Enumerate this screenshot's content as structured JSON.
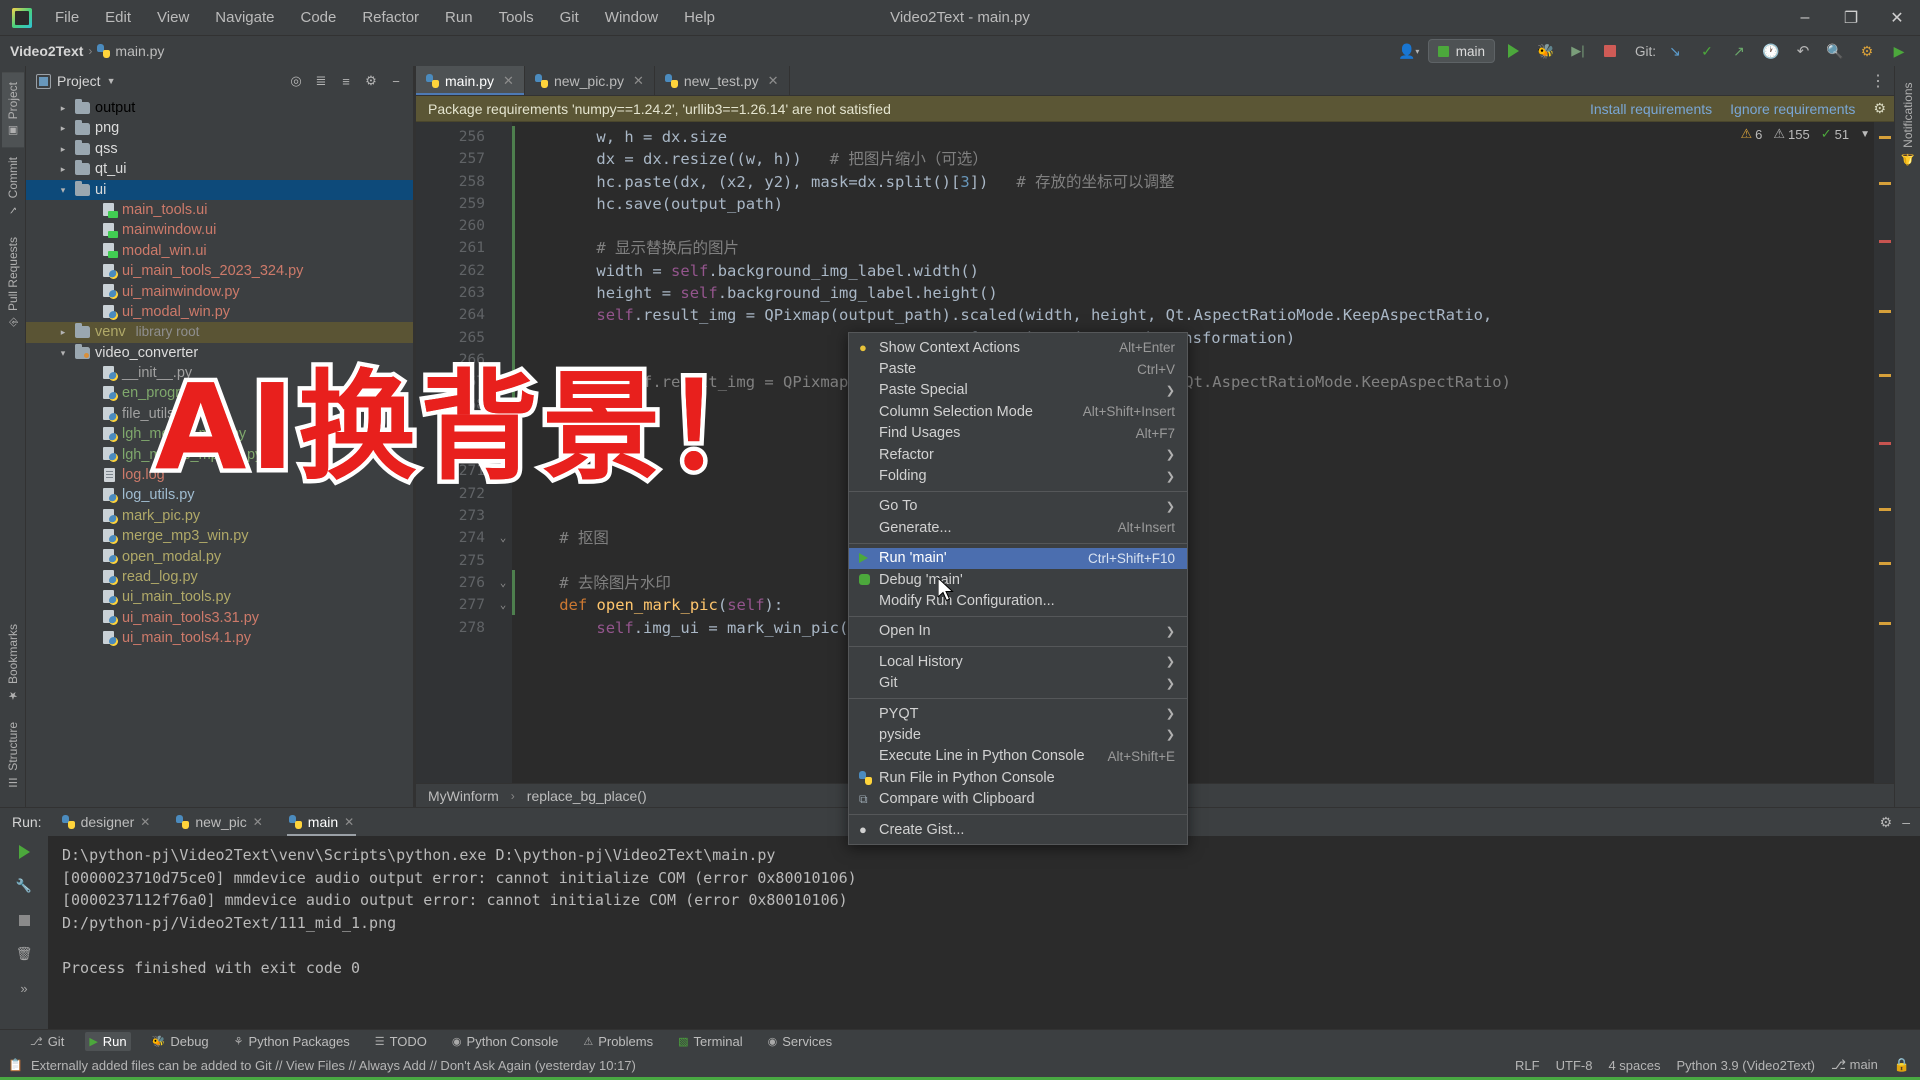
{
  "window": {
    "title": "Video2Text - main.py",
    "logo_icon": "pycharm-logo-icon",
    "minimize_icon": "–",
    "maximize_icon": "❐",
    "close_icon": "✕"
  },
  "menubar": [
    "File",
    "Edit",
    "View",
    "Navigate",
    "Code",
    "Refactor",
    "Run",
    "Tools",
    "Git",
    "Window",
    "Help"
  ],
  "breadcrumb": {
    "project": "Video2Text",
    "file": "main.py",
    "separator": "›"
  },
  "toolbar": {
    "account_icon": "user-icon",
    "run_config": "main",
    "run_icon": "run-icon",
    "debug_icon": "debug-icon",
    "coverage_icon": "coverage-icon",
    "stop_icon": "stop-icon",
    "git_label": "Git:",
    "git_update_icon": "update-project-icon",
    "git_commit_icon": "commit-icon",
    "git_push_icon": "push-icon",
    "history_icon": "history-icon",
    "undo_icon": "undo-icon",
    "search_icon": "search-icon",
    "settings_icon": "settings-icon",
    "plugin_icon": "plugin-icon"
  },
  "left_rail": {
    "tabs": [
      "Project",
      "Commit",
      "Pull Requests"
    ]
  },
  "right_rail": {
    "tabs": [
      "Notifications"
    ]
  },
  "bottom_rail": {
    "tabs": [
      "Bookmarks",
      "Structure"
    ]
  },
  "project_panel": {
    "title": "Project",
    "caret_icon": "chevron-down-icon",
    "actions": [
      "target-icon",
      "collapse-icon",
      "settings-gear-icon",
      "more-icon",
      "hide-icon"
    ],
    "tree": [
      {
        "label": "output",
        "type": "folder",
        "indent": 0,
        "arrow": "›",
        "color": "out"
      },
      {
        "label": "png",
        "type": "folder",
        "indent": 0,
        "arrow": "›",
        "color": "dir"
      },
      {
        "label": "qss",
        "type": "folder",
        "indent": 0,
        "arrow": "›",
        "color": "dir"
      },
      {
        "label": "qt_ui",
        "type": "folder",
        "indent": 0,
        "arrow": "›",
        "color": "dir"
      },
      {
        "label": "ui",
        "type": "folder",
        "indent": 0,
        "arrow": "⌄",
        "color": "dir",
        "selected": true
      },
      {
        "label": "main_tools.ui",
        "type": "ui",
        "indent": 1,
        "color": "red"
      },
      {
        "label": "mainwindow.ui",
        "type": "ui",
        "indent": 1,
        "color": "red"
      },
      {
        "label": "modal_win.ui",
        "type": "ui",
        "indent": 1,
        "color": "red"
      },
      {
        "label": "ui_main_tools_2023_324.py",
        "type": "py",
        "indent": 1,
        "color": "red"
      },
      {
        "label": "ui_mainwindow.py",
        "type": "py",
        "indent": 1,
        "color": "red"
      },
      {
        "label": "ui_modal_win.py",
        "type": "py",
        "indent": 1,
        "color": "red"
      },
      {
        "label": "venv",
        "type": "folder",
        "indent": 0,
        "arrow": "›",
        "color": "olive",
        "meta": "library root",
        "venv_selected": true
      },
      {
        "label": "video_converter",
        "type": "folder-src",
        "indent": 0,
        "arrow": "⌄",
        "color": "dir"
      },
      {
        "label": "__init__.py",
        "type": "py",
        "indent": 1,
        "color": "gray"
      },
      {
        "label": "en_program.py",
        "type": "py",
        "indent": 1,
        "color": "green"
      },
      {
        "label": "file_utils.py",
        "type": "py",
        "indent": 1,
        "color": "gray"
      },
      {
        "label": "lgh_merge_mp3.py",
        "type": "py",
        "indent": 1,
        "color": "green"
      },
      {
        "label": "lgh_merge_mp3_2.py",
        "type": "py",
        "indent": 1,
        "color": "green"
      },
      {
        "label": "log.log",
        "type": "log",
        "indent": 1,
        "color": "red"
      },
      {
        "label": "log_utils.py",
        "type": "py",
        "indent": 1,
        "color": "blue"
      },
      {
        "label": "mark_pic.py",
        "type": "py",
        "indent": 1,
        "color": "olive"
      },
      {
        "label": "merge_mp3_win.py",
        "type": "py",
        "indent": 1,
        "color": "olive"
      },
      {
        "label": "open_modal.py",
        "type": "py",
        "indent": 1,
        "color": "olive"
      },
      {
        "label": "read_log.py",
        "type": "py",
        "indent": 1,
        "color": "olive"
      },
      {
        "label": "ui_main_tools.py",
        "type": "py",
        "indent": 1,
        "color": "olive"
      },
      {
        "label": "ui_main_tools3.31.py",
        "type": "py",
        "indent": 1,
        "color": "red"
      },
      {
        "label": "ui_main_tools4.1.py",
        "type": "py",
        "indent": 1,
        "color": "red"
      }
    ]
  },
  "editor": {
    "tabs": [
      {
        "label": "main.py",
        "icon": "python-file-icon",
        "active": true,
        "close": "✕"
      },
      {
        "label": "new_pic.py",
        "icon": "python-file-icon",
        "active": false,
        "close": "✕"
      },
      {
        "label": "new_test.py",
        "icon": "python-file-icon",
        "active": false,
        "close": "✕"
      }
    ],
    "more_icon": "more-vertical-icon",
    "notification": {
      "message": "Package requirements 'numpy==1.24.2', 'urllib3==1.26.14' are not satisfied",
      "install_link": "Install requirements",
      "ignore_link": "Ignore requirements",
      "settings_icon": "gear-icon"
    },
    "inspections": {
      "warning_icon": "warning-icon",
      "warning_count": "6",
      "weak_icon": "weak-warning-icon",
      "weak_count": "155",
      "ok_icon": "check-icon",
      "ok_count": "51",
      "more_icon": "chevron-down-icon"
    },
    "first_line": 256,
    "lines": [
      {
        "n": 256,
        "text": "w, h = dx.size",
        "indent": 8
      },
      {
        "n": 257,
        "text": "dx = dx.resize((w, h))   # 把图片缩小（可选）",
        "indent": 8
      },
      {
        "n": 258,
        "text": "hc.paste(dx, (x2, y2), mask=dx.split()[3])   # 存放的坐标可以调整",
        "indent": 8
      },
      {
        "n": 259,
        "text": "hc.save(output_path)",
        "indent": 8
      },
      {
        "n": 260,
        "text": "",
        "indent": 8
      },
      {
        "n": 261,
        "text": "# 显示替换后的图片",
        "indent": 8
      },
      {
        "n": 262,
        "text": "width = self.background_img_label.width()",
        "indent": 8
      },
      {
        "n": 263,
        "text": "height = self.background_img_label.height()",
        "indent": 8
      },
      {
        "n": 264,
        "text": "self.result_img = QPixmap(output_path).scaled(width, height, Qt.AspectRatioMode.KeepAspectRatio,",
        "indent": 8
      },
      {
        "n": 265,
        "text": "Qt.TransformationMode.SmoothTransformation)",
        "indent": 40
      },
      {
        "n": 266,
        "text": "",
        "indent": 8
      },
      {
        "n": 267,
        "text": "# self.result_img = QPixmap(output_path).scaled(width, height, Qt.AspectRatioMode.KeepAspectRatio)",
        "indent": 8
      },
      {
        "n": 268,
        "text": "",
        "indent": 8
      },
      {
        "n": 269,
        "text": "",
        "indent": 8
      },
      {
        "n": 270,
        "text": "",
        "indent": 8
      },
      {
        "n": 271,
        "text": "",
        "indent": 8
      },
      {
        "n": 272,
        "text": "",
        "indent": 8
      },
      {
        "n": 273,
        "text": "",
        "indent": 8
      },
      {
        "n": 274,
        "text": "# 抠图",
        "indent": 4
      },
      {
        "n": 275,
        "text": "",
        "indent": 4
      },
      {
        "n": 276,
        "text": "# 去除图片水印",
        "indent": 4
      },
      {
        "n": 277,
        "text": "def open_mark_pic(self):",
        "indent": 4
      },
      {
        "n": 278,
        "text": "self.img_ui = mark_win_pic()",
        "indent": 8
      }
    ],
    "breadcrumbs": [
      "MyWinform",
      "replace_bg_place()"
    ],
    "breadcrumb_sep": "›"
  },
  "overlay": {
    "text": "AI换背景！"
  },
  "context_menu": {
    "items": [
      {
        "label": "Show Context Actions",
        "accel": "Alt+Enter",
        "icon": "lightbulb-icon"
      },
      {
        "label": "Paste",
        "accel": "Ctrl+V",
        "icon": ""
      },
      {
        "label": "Paste Special",
        "accel": "",
        "submenu": true,
        "icon": ""
      },
      {
        "label": "Column Selection Mode",
        "accel": "Alt+Shift+Insert",
        "icon": ""
      },
      {
        "label": "Find Usages",
        "accel": "Alt+F7",
        "icon": ""
      },
      {
        "label": "Refactor",
        "accel": "",
        "submenu": true,
        "icon": ""
      },
      {
        "label": "Folding",
        "accel": "",
        "submenu": true,
        "icon": ""
      },
      {
        "sep": true
      },
      {
        "label": "Go To",
        "accel": "",
        "submenu": true,
        "icon": ""
      },
      {
        "label": "Generate...",
        "accel": "Alt+Insert",
        "icon": ""
      },
      {
        "sep": true
      },
      {
        "label": "Run 'main'",
        "accel": "Ctrl+Shift+F10",
        "icon": "run-icon",
        "selected": true
      },
      {
        "label": "Debug 'main'",
        "accel": "",
        "icon": "debug-icon"
      },
      {
        "label": "Modify Run Configuration...",
        "accel": "",
        "icon": ""
      },
      {
        "sep": true
      },
      {
        "label": "Open In",
        "accel": "",
        "submenu": true,
        "icon": ""
      },
      {
        "sep": true
      },
      {
        "label": "Local History",
        "accel": "",
        "submenu": true,
        "icon": ""
      },
      {
        "label": "Git",
        "accel": "",
        "submenu": true,
        "icon": ""
      },
      {
        "sep": true
      },
      {
        "label": "PYQT",
        "accel": "",
        "submenu": true,
        "icon": ""
      },
      {
        "label": "pyside",
        "accel": "",
        "submenu": true,
        "icon": ""
      },
      {
        "label": "Execute Line in Python Console",
        "accel": "Alt+Shift+E",
        "icon": ""
      },
      {
        "label": "Run File in Python Console",
        "accel": "",
        "icon": "python-icon"
      },
      {
        "label": "Compare with Clipboard",
        "accel": "",
        "icon": "compare-icon"
      },
      {
        "sep": true
      },
      {
        "label": "Create Gist...",
        "accel": "",
        "icon": "github-icon"
      }
    ]
  },
  "run_panel": {
    "label": "Run:",
    "tabs": [
      {
        "label": "designer",
        "icon": "python-icon",
        "close": "✕",
        "active": false
      },
      {
        "label": "new_pic",
        "icon": "python-icon",
        "close": "✕",
        "active": false
      },
      {
        "label": "main",
        "icon": "python-icon",
        "close": "✕",
        "active": true
      }
    ],
    "settings_icon": "gear-icon",
    "minimize_icon": "–",
    "gutter_icons": [
      "rerun-icon",
      "wrench-icon",
      "stop-icon",
      "trash-icon",
      "expand-icon"
    ],
    "console": [
      "D:\\python-pj\\Video2Text\\venv\\Scripts\\python.exe D:\\python-pj\\Video2Text\\main.py",
      "[0000023710d75ce0] mmdevice audio output error: cannot initialize COM (error 0x80010106)",
      "[0000237112f76a0] mmdevice audio output error: cannot initialize COM (error 0x80010106)",
      "D:/python-pj/Video2Text/111_mid_1.png",
      "",
      "Process finished with exit code 0"
    ]
  },
  "tool_strip": [
    {
      "label": "Git",
      "icon": "git-icon",
      "active": false
    },
    {
      "label": "Run",
      "icon": "run-icon",
      "active": true
    },
    {
      "label": "Debug",
      "icon": "debug-icon",
      "active": false
    },
    {
      "label": "Python Packages",
      "icon": "packages-icon",
      "active": false
    },
    {
      "label": "TODO",
      "icon": "todo-icon",
      "active": false
    },
    {
      "label": "Python Console",
      "icon": "console-icon",
      "active": false
    },
    {
      "label": "Problems",
      "icon": "problems-icon",
      "active": false
    },
    {
      "label": "Terminal",
      "icon": "terminal-icon",
      "active": false
    },
    {
      "label": "Services",
      "icon": "services-icon",
      "active": false
    }
  ],
  "status_bar": {
    "icon": "event-log-icon",
    "message": "Externally added files can be added to Git // View Files // Always Add // Don't Ask Again (yesterday 10:17)",
    "line_sep": "RLF",
    "encoding": "UTF-8",
    "indent": "4 spaces",
    "interpreter": "Python 3.9 (Video2Text)",
    "branch_icon": "branch-icon",
    "branch": "main",
    "lock_icon": "lock-icon"
  }
}
